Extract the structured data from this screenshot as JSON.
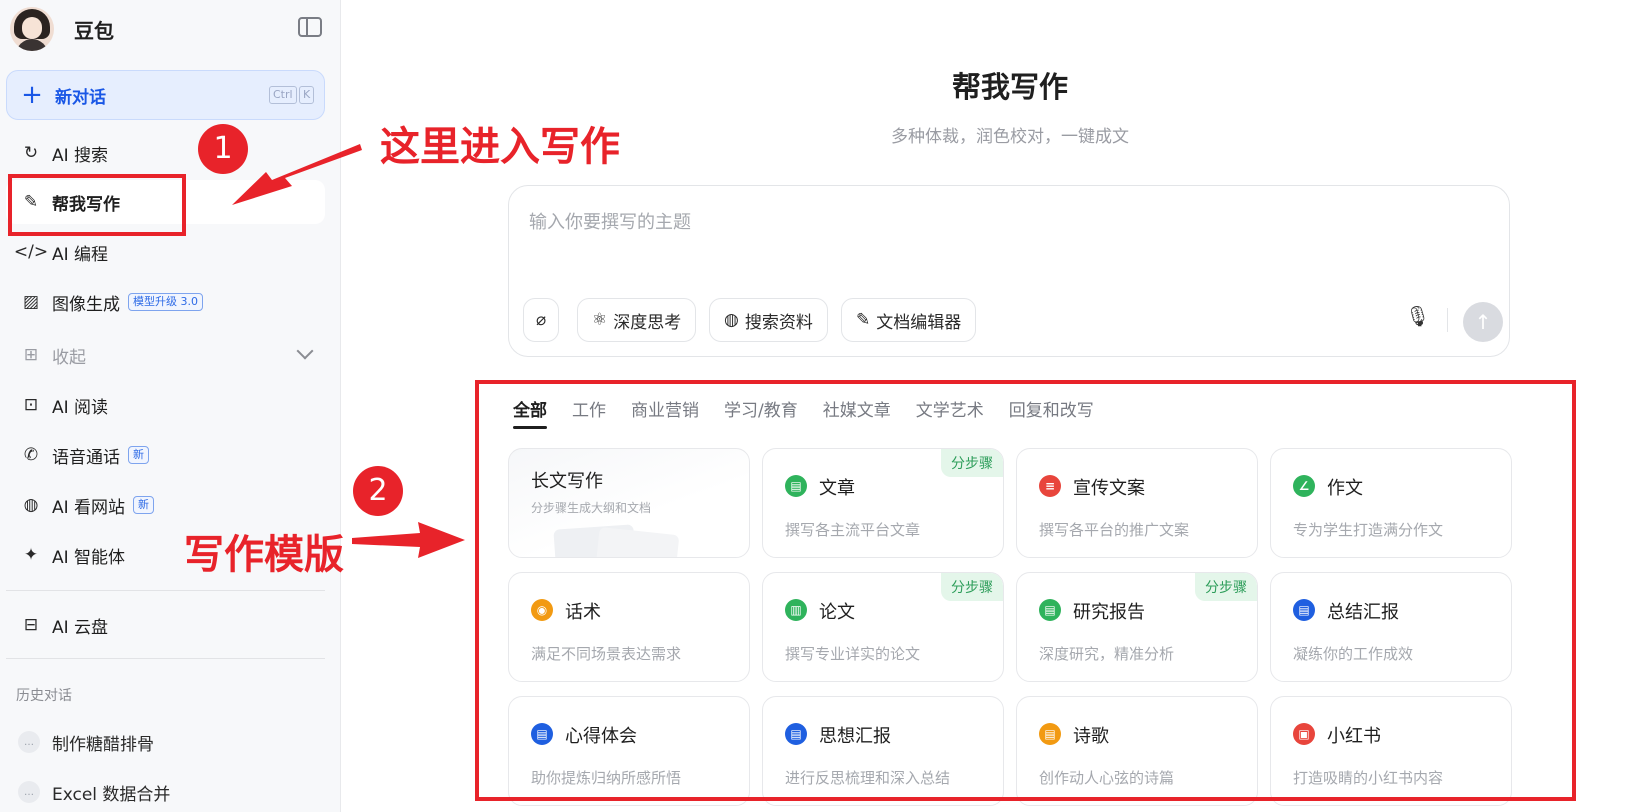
{
  "sidebar": {
    "brand_name": "豆包",
    "new_chat": {
      "label": "新对话",
      "kbd_ctrl": "Ctrl",
      "kbd_key": "K"
    },
    "items": [
      {
        "label": "AI 搜索",
        "icon": "search-icon"
      },
      {
        "label": "帮我写作",
        "icon": "pen-icon"
      },
      {
        "label": "AI 编程",
        "icon": "code-icon"
      },
      {
        "label": "图像生成",
        "icon": "image-icon",
        "badge": "模型升级 3.0"
      },
      {
        "label": "收起",
        "icon": "apps-icon"
      },
      {
        "label": "AI 阅读",
        "icon": "read-icon"
      },
      {
        "label": "语音通话",
        "icon": "phone-icon",
        "badge": "新"
      },
      {
        "label": "AI 看网站",
        "icon": "globe-icon",
        "badge": "新"
      },
      {
        "label": "AI 智能体",
        "icon": "sparkle-icon"
      },
      {
        "label": "AI 云盘",
        "icon": "cloud-drive-icon"
      }
    ],
    "history_title": "历史对话",
    "history": [
      {
        "label": "制作糖醋排骨"
      },
      {
        "label": "Excel 数据合并"
      }
    ]
  },
  "main": {
    "title": "帮我写作",
    "subtitle": "多种体裁，润色校对，一键成文",
    "composer": {
      "placeholder": "输入你要撰写的主题",
      "tools": [
        {
          "label": "深度思考",
          "icon": "atom-icon"
        },
        {
          "label": "搜索资料",
          "icon": "globe-icon"
        },
        {
          "label": "文档编辑器",
          "icon": "edit-doc-icon"
        }
      ]
    },
    "tabs": [
      "全部",
      "工作",
      "商业营销",
      "学习/教育",
      "社媒文章",
      "文学艺术",
      "回复和改写"
    ],
    "cards": [
      {
        "title": "长文写作",
        "desc": "分步骤生成大纲和文档"
      },
      {
        "title": "文章",
        "desc": "撰写各主流平台文章",
        "tag": "分步骤",
        "color": "#2fb35c",
        "glyph": "▤"
      },
      {
        "title": "宣传文案",
        "desc": "撰写各平台的推广文案",
        "color": "#e8453c",
        "glyph": "≡"
      },
      {
        "title": "作文",
        "desc": "专为学生打造满分作文",
        "color": "#2fb35c",
        "glyph": "∠"
      },
      {
        "title": "话术",
        "desc": "满足不同场景表达需求",
        "color": "#f29a12",
        "glyph": "◉"
      },
      {
        "title": "论文",
        "desc": "撰写专业详实的论文",
        "tag": "分步骤",
        "color": "#2fb35c",
        "glyph": "▥"
      },
      {
        "title": "研究报告",
        "desc": "深度研究，精准分析",
        "tag": "分步骤",
        "color": "#2fb35c",
        "glyph": "▤"
      },
      {
        "title": "总结汇报",
        "desc": "凝练你的工作成效",
        "color": "#1f5fe0",
        "glyph": "▤"
      },
      {
        "title": "心得体会",
        "desc": "助你提炼归纳所感所悟",
        "color": "#1f5fe0",
        "glyph": "▤"
      },
      {
        "title": "思想汇报",
        "desc": "进行反思梳理和深入总结",
        "color": "#1f5fe0",
        "glyph": "▤"
      },
      {
        "title": "诗歌",
        "desc": "创作动人心弦的诗篇",
        "color": "#f29a12",
        "glyph": "▤"
      },
      {
        "title": "小红书",
        "desc": "打造吸睛的小红书内容",
        "color": "#e8453c",
        "glyph": "▣"
      }
    ]
  },
  "annotations": {
    "num1": "1",
    "num2": "2",
    "text1": "这里进入写作",
    "text2": "写作模版",
    "color": "#e8232a"
  }
}
